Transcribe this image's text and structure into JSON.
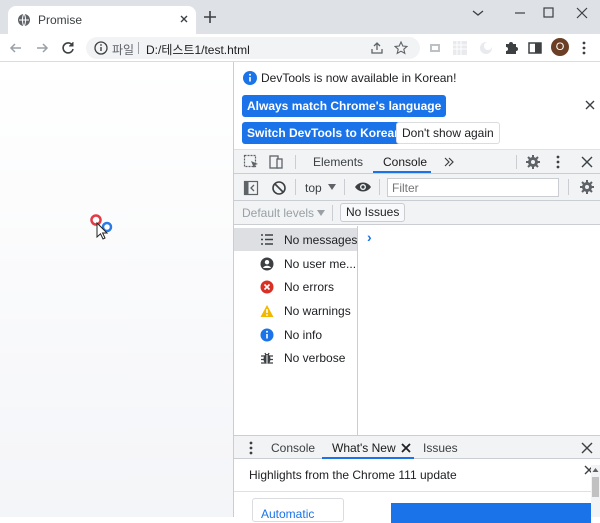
{
  "browser": {
    "tab_title": "Promise",
    "url_scheme_label": "파일",
    "url": "D:/테스트1/test.html",
    "profile_initial": "O"
  },
  "devtools": {
    "notice": {
      "text": "DevTools is now available in Korean!",
      "btn_match": "Always match Chrome's language",
      "btn_switch": "Switch DevTools to Korean",
      "btn_dont_show": "Don't show again"
    },
    "tabs": [
      "Elements",
      "Console"
    ],
    "active_tab": "Console",
    "console": {
      "context": "top",
      "filter_placeholder": "Filter",
      "levels": "Default levels",
      "issues": "No Issues",
      "sidebar": [
        {
          "label": "No messages",
          "icon": "list-icon"
        },
        {
          "label": "No user me...",
          "icon": "user-icon"
        },
        {
          "label": "No errors",
          "icon": "error-icon"
        },
        {
          "label": "No warnings",
          "icon": "warning-icon"
        },
        {
          "label": "No info",
          "icon": "info-icon"
        },
        {
          "label": "No verbose",
          "icon": "bug-icon"
        }
      ],
      "prompt": "›"
    },
    "drawer": {
      "tabs": [
        "Console",
        "What's New",
        "Issues"
      ],
      "active_tab": "What's New",
      "heading": "Highlights from the Chrome 111 update",
      "card_text": "Automatic"
    },
    "colors": {
      "accent": "#1a73e8",
      "error": "#d93025",
      "warning": "#f2b700"
    }
  }
}
